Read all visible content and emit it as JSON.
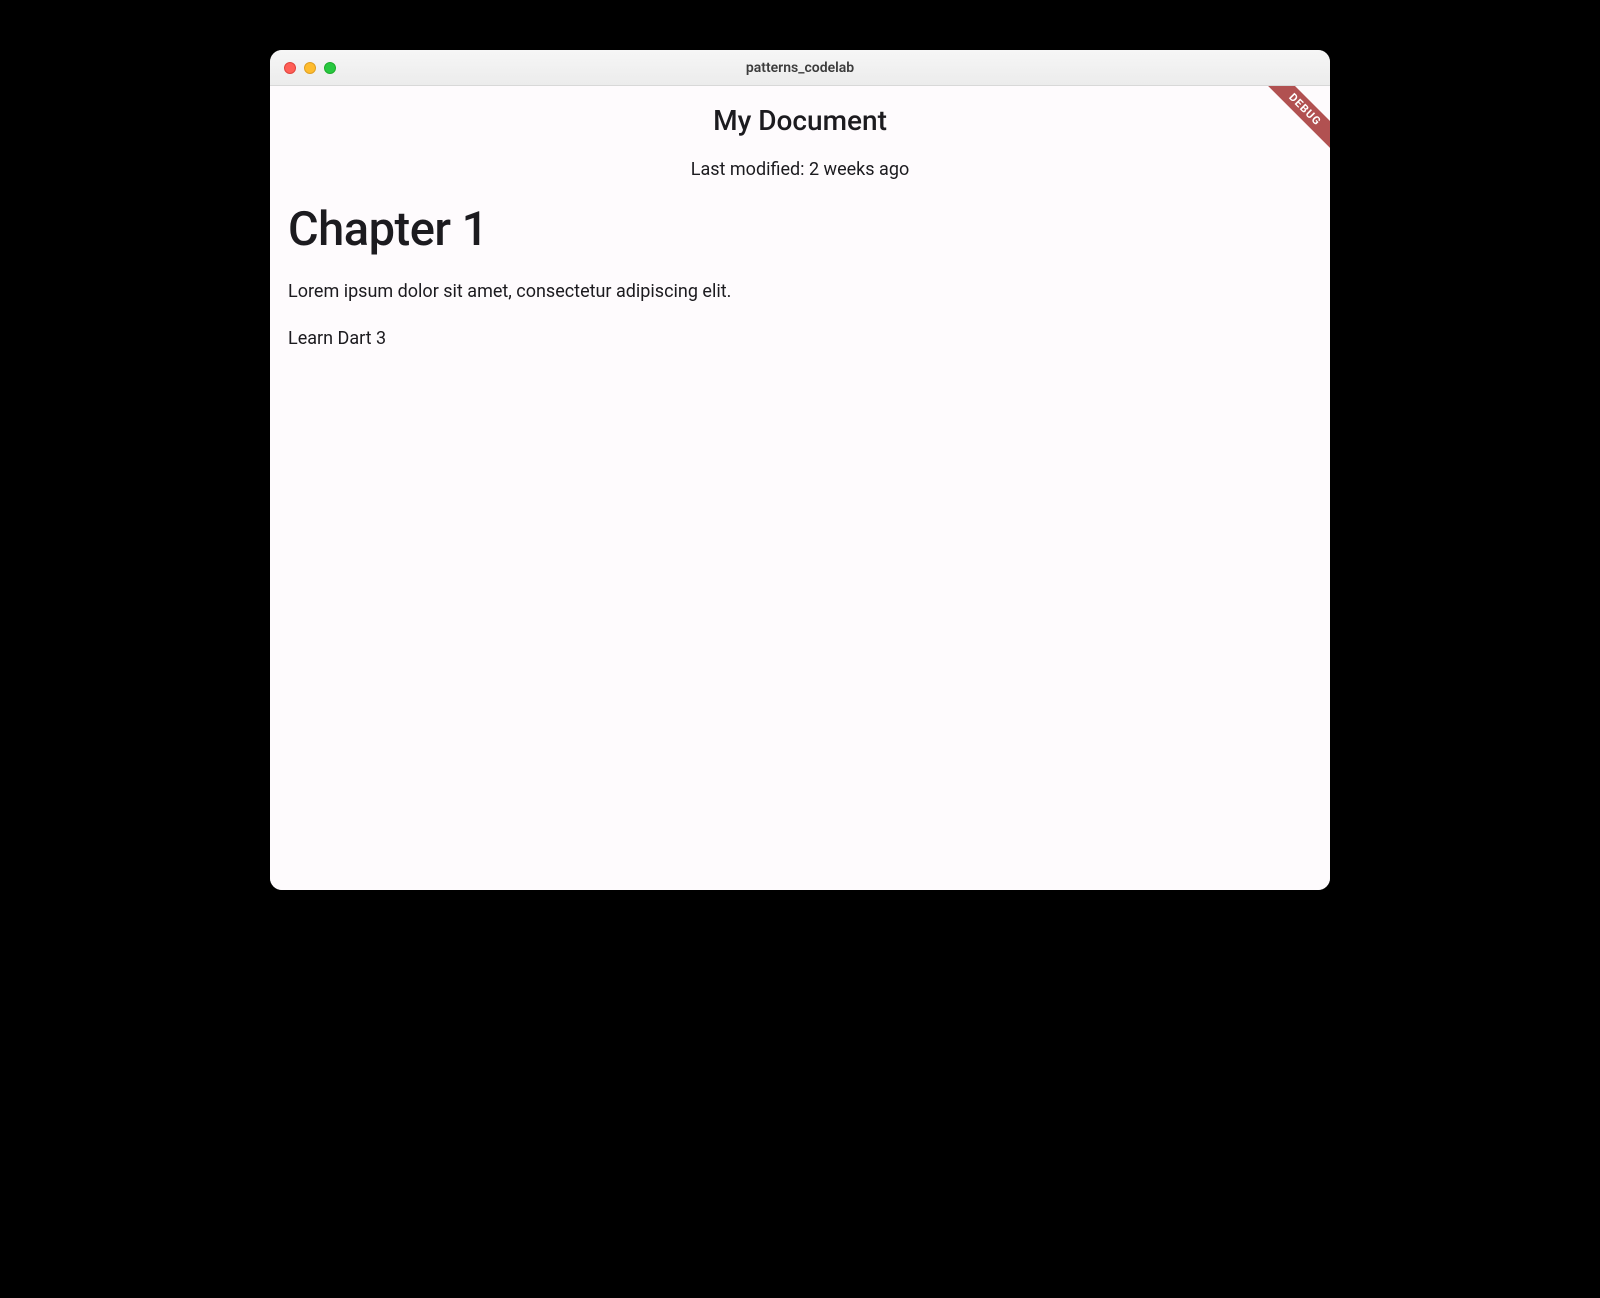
{
  "window": {
    "title": "patterns_codelab"
  },
  "debug_banner": "DEBUG",
  "document": {
    "title": "My Document",
    "last_modified": "Last modified: 2 weeks ago",
    "blocks": [
      {
        "type": "heading",
        "text": "Chapter 1"
      },
      {
        "type": "paragraph",
        "text": "Lorem ipsum dolor sit amet, consectetur adipiscing elit."
      },
      {
        "type": "paragraph",
        "text": "Learn Dart 3"
      }
    ]
  }
}
